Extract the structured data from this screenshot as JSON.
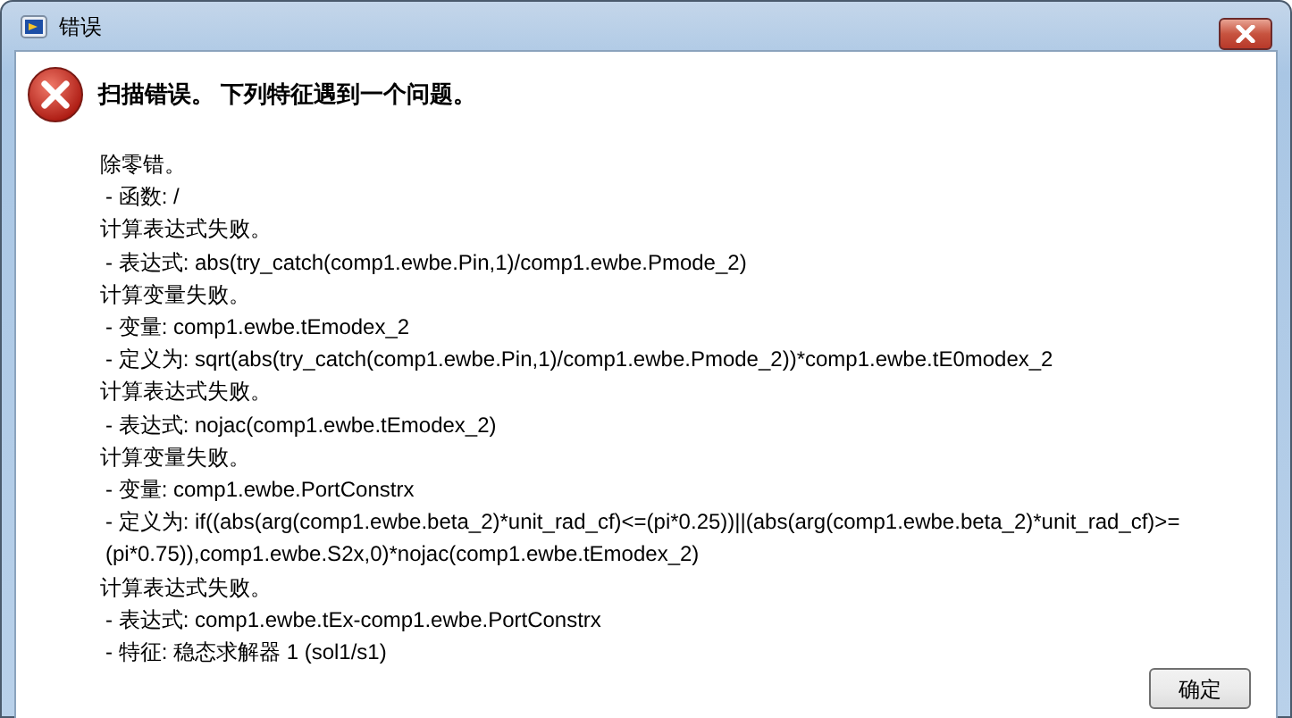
{
  "window": {
    "title": "错误"
  },
  "header": "扫描错误。 下列特征遇到一个问题。",
  "details": [
    {
      "kind": "message",
      "text": "除零错。"
    },
    {
      "kind": "detail",
      "text": "- 函数: /"
    },
    {
      "kind": "message",
      "text": "计算表达式失败。"
    },
    {
      "kind": "detail",
      "text": "- 表达式: abs(try_catch(comp1.ewbe.Pin,1)/comp1.ewbe.Pmode_2)"
    },
    {
      "kind": "message",
      "text": "计算变量失败。"
    },
    {
      "kind": "detail",
      "text": "- 变量: comp1.ewbe.tEmodex_2"
    },
    {
      "kind": "detail",
      "text": "- 定义为: sqrt(abs(try_catch(comp1.ewbe.Pin,1)/comp1.ewbe.Pmode_2))*comp1.ewbe.tE0modex_2"
    },
    {
      "kind": "message",
      "text": "计算表达式失败。"
    },
    {
      "kind": "detail",
      "text": "- 表达式: nojac(comp1.ewbe.tEmodex_2)"
    },
    {
      "kind": "message",
      "text": "计算变量失败。"
    },
    {
      "kind": "detail",
      "text": "- 变量: comp1.ewbe.PortConstrx"
    },
    {
      "kind": "detail",
      "text": "- 定义为: if((abs(arg(comp1.ewbe.beta_2)*unit_rad_cf)<=(pi*0.25))||(abs(arg(comp1.ewbe.beta_2)*unit_rad_cf)>=(pi*0.75)),comp1.ewbe.S2x,0)*nojac(comp1.ewbe.tEmodex_2)"
    },
    {
      "kind": "message",
      "text": "计算表达式失败。"
    },
    {
      "kind": "detail",
      "text": "- 表达式: comp1.ewbe.tEx-comp1.ewbe.PortConstrx"
    },
    {
      "kind": "detail",
      "text": "- 特征: 稳态求解器 1 (sol1/s1)"
    }
  ],
  "buttons": [
    "确定"
  ]
}
